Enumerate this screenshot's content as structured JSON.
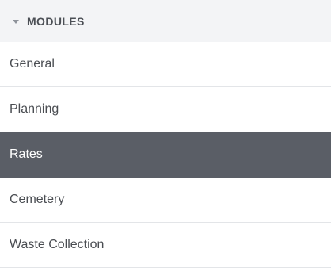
{
  "modules": {
    "header_label": "MODULES",
    "items": [
      {
        "label": "General",
        "active": false
      },
      {
        "label": "Planning",
        "active": false
      },
      {
        "label": "Rates",
        "active": true
      },
      {
        "label": "Cemetery",
        "active": false
      },
      {
        "label": "Waste Collection",
        "active": false
      }
    ]
  },
  "colors": {
    "header_bg": "#f3f4f6",
    "active_bg": "#5a5e66",
    "active_text": "#ffffff",
    "text": "#4a4d52",
    "divider": "#e3e5e8"
  },
  "icons": {
    "header_caret": "caret-down-icon"
  }
}
